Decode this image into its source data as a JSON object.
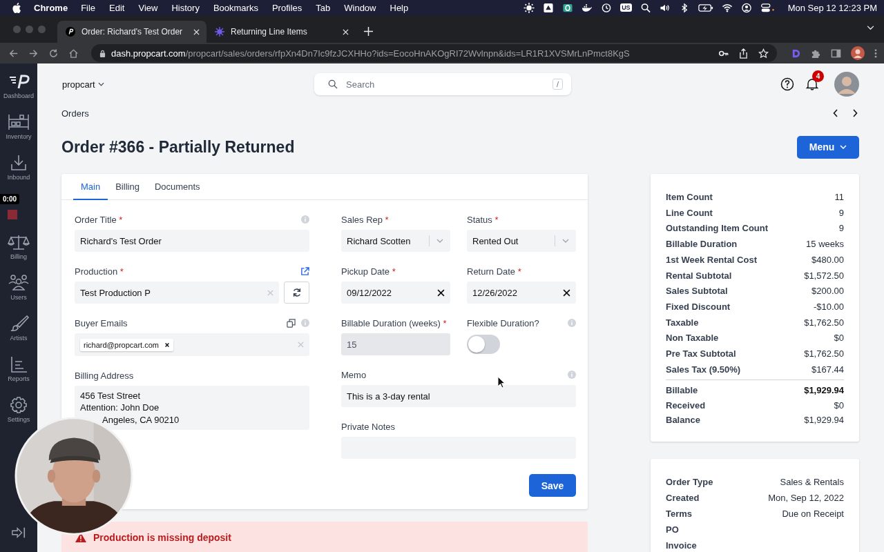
{
  "menubar": {
    "app": "Chrome",
    "menus": [
      "File",
      "Edit",
      "View",
      "History",
      "Bookmarks",
      "Profiles",
      "Tab",
      "Window",
      "Help"
    ],
    "input_source": "US",
    "clock": "Mon Sep 12  12:23 PM"
  },
  "browser": {
    "tabs": [
      {
        "title": "Order: Richard's Test Order",
        "selected": true,
        "kind": "propcart"
      },
      {
        "title": "Returning Line Items",
        "selected": false,
        "kind": "sunburst"
      }
    ],
    "url_host": "dash.propcart.com",
    "url_path": "/propcart/sales/orders/rfpXn4Dn7Ic9fzJCXHHo?ids=EocoHnAKOgRI72Wvlnpn&ids=LR1R1XVSMrLnPmct8KgS"
  },
  "sidebar": {
    "items": [
      {
        "label": "Dashboard",
        "kind": "logo"
      },
      {
        "label": "Inventory",
        "kind": "shelf"
      },
      {
        "label": "Inbound",
        "kind": "inbound"
      },
      {
        "label": "Billing",
        "kind": "scale"
      },
      {
        "label": "Users",
        "kind": "users"
      },
      {
        "label": "Artists",
        "kind": "brush"
      },
      {
        "label": "Reports",
        "kind": "chart"
      },
      {
        "label": "Settings",
        "kind": "gear"
      }
    ]
  },
  "recording": {
    "timer": "0:00"
  },
  "header": {
    "organization": "propcart",
    "search": {
      "placeholder": "Search",
      "shortcut": "/"
    },
    "notification_count": "4"
  },
  "breadcrumb": "Orders",
  "title": "Order #366 - Partially Returned",
  "menu_button": "Menu",
  "form": {
    "tabs": [
      {
        "label": "Main",
        "selected": true
      },
      {
        "label": "Billing",
        "selected": false
      },
      {
        "label": "Documents",
        "selected": false
      }
    ],
    "order_title": {
      "label": "Order Title",
      "marker": "*",
      "value": "Richard's Test Order"
    },
    "production": {
      "label": "Production",
      "marker": "*",
      "value": "Test Production P"
    },
    "buyer_emails": {
      "label": "Buyer Emails",
      "chips": [
        "richard@propcart.com"
      ]
    },
    "billing_address": {
      "label": "Billing Address",
      "lines": [
        "456 Test Street",
        "Attention: John Doe",
        "Angeles, CA 90210"
      ]
    },
    "sales_rep": {
      "label": "Sales Rep",
      "marker": "*",
      "value": "Richard Scotten"
    },
    "status": {
      "label": "Status",
      "marker": "*",
      "value": "Rented Out"
    },
    "pickup_date": {
      "label": "Pickup Date",
      "marker": "*",
      "value": "09/12/2022"
    },
    "return_date": {
      "label": "Return Date",
      "marker": "*",
      "value": "12/26/2022"
    },
    "billable_duration": {
      "label": "Billable Duration (weeks)",
      "marker": "*",
      "value": "15",
      "disabled": true
    },
    "flexible_duration": {
      "label": "Flexible Duration?",
      "on": false
    },
    "memo": {
      "label": "Memo",
      "value": "This is a 3-day rental"
    },
    "private_notes": {
      "label": "Private Notes"
    },
    "save_button": "Save"
  },
  "summary": {
    "rows": [
      {
        "label": "Item Count",
        "value": "11"
      },
      {
        "label": "Line Count",
        "value": "9"
      },
      {
        "label": "Outstanding Item Count",
        "value": "9"
      },
      {
        "label": "Billable Duration",
        "value": "15 weeks"
      },
      {
        "label": "1st Week Rental Cost",
        "value": "$480.00"
      },
      {
        "label": "Rental Subtotal",
        "value": "$1,572.50"
      },
      {
        "label": "Sales Subtotal",
        "value": "$200.00"
      },
      {
        "label": "Fixed Discount",
        "value": "-$10.00"
      },
      {
        "label": "Taxable",
        "value": "$1,762.50"
      },
      {
        "label": "Non Taxable",
        "value": "$0"
      },
      {
        "label": "Pre Tax Subtotal",
        "value": "$1,762.50"
      },
      {
        "label": "Sales Tax (9.50%)",
        "value": "$167.44"
      }
    ],
    "totals": [
      {
        "label": "Billable",
        "value": "$1,929.94",
        "bold": true
      },
      {
        "label": "Received",
        "value": "$0",
        "bold": false
      },
      {
        "label": "Balance",
        "value": "$1,929.94",
        "bold": false
      }
    ]
  },
  "details": {
    "rows": [
      {
        "label": "Order Type",
        "value": "Sales & Rentals"
      },
      {
        "label": "Created",
        "value": "Mon, Sep 12, 2022"
      },
      {
        "label": "Terms",
        "value": "Due on Receipt"
      },
      {
        "label": "PO"
      },
      {
        "label": "Invoice"
      }
    ]
  },
  "alerts": [
    {
      "text": "Production is missing deposit"
    }
  ]
}
